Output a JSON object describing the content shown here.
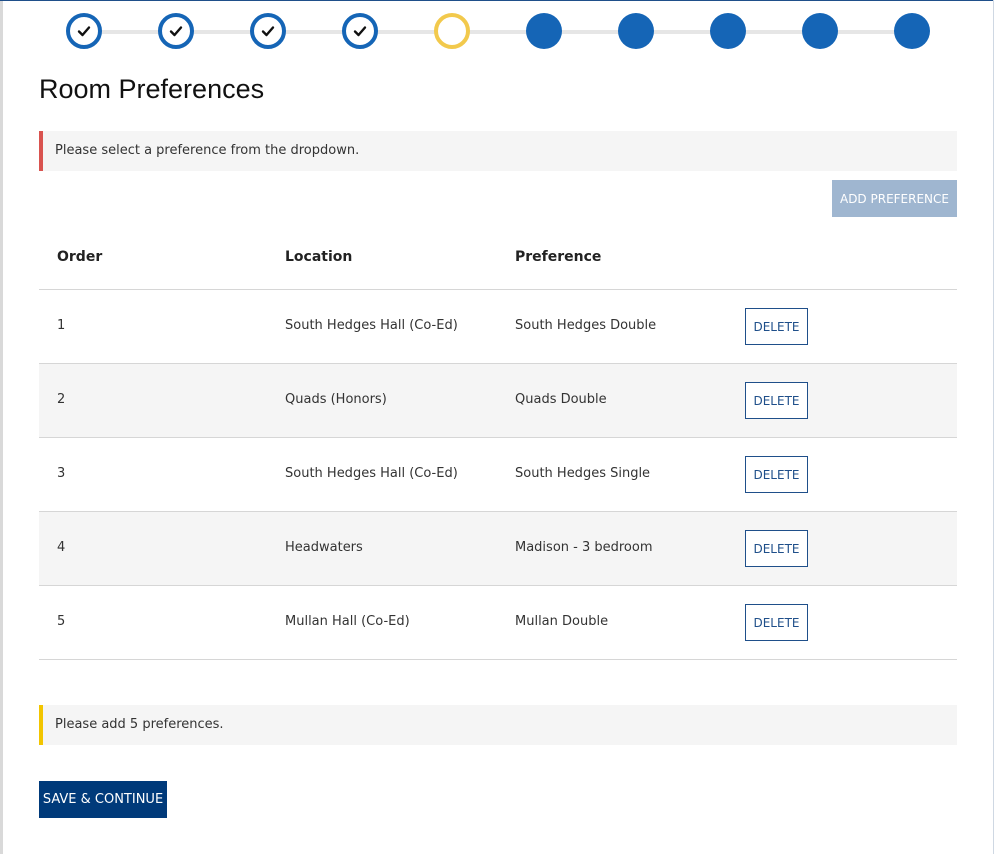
{
  "steps": [
    {
      "status": "complete",
      "icon": "check-icon"
    },
    {
      "status": "complete",
      "icon": "check-icon"
    },
    {
      "status": "complete",
      "icon": "check-icon"
    },
    {
      "status": "complete",
      "icon": "check-icon"
    },
    {
      "status": "current"
    },
    {
      "status": "incomplete"
    },
    {
      "status": "incomplete"
    },
    {
      "status": "incomplete"
    },
    {
      "status": "incomplete"
    },
    {
      "status": "incomplete"
    }
  ],
  "page_title": "Room Preferences",
  "error_alert": "Please select a preference from the dropdown.",
  "add_preference_label": "ADD PREFERENCE",
  "table": {
    "headers": {
      "order": "Order",
      "location": "Location",
      "preference": "Preference"
    },
    "rows": [
      {
        "order": "1",
        "location": "South Hedges Hall (Co-Ed)",
        "preference": "South Hedges Double",
        "action": "DELETE"
      },
      {
        "order": "2",
        "location": "Quads (Honors)",
        "preference": "Quads Double",
        "action": "DELETE"
      },
      {
        "order": "3",
        "location": "South Hedges Hall (Co-Ed)",
        "preference": "South Hedges Single",
        "action": "DELETE"
      },
      {
        "order": "4",
        "location": "Headwaters",
        "preference": "Madison - 3 bedroom",
        "action": "DELETE"
      },
      {
        "order": "5",
        "location": "Mullan Hall (Co-Ed)",
        "preference": "Mullan Double",
        "action": "DELETE"
      }
    ]
  },
  "warning_alert": "Please add 5 preferences.",
  "save_label": "SAVE & CONTINUE",
  "colors": {
    "primary": "#1565b6",
    "dark_primary": "#003a7a",
    "current_step": "#f2c94c",
    "error": "#d9534f",
    "warning": "#f2c500",
    "disabled_button": "#9fb6d0"
  }
}
